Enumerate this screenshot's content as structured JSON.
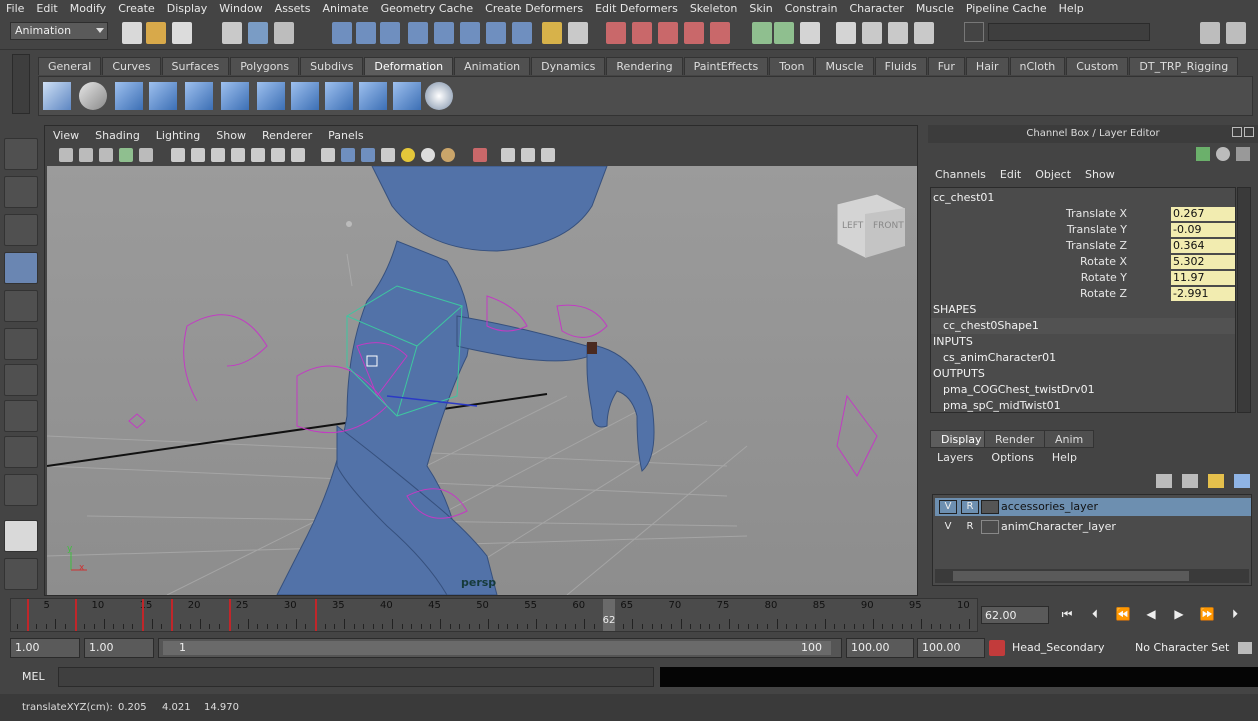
{
  "menubar": [
    "File",
    "Edit",
    "Modify",
    "Create",
    "Display",
    "Window",
    "Assets",
    "Animate",
    "Geometry Cache",
    "Create Deformers",
    "Edit Deformers",
    "Skeleton",
    "Skin",
    "Constrain",
    "Character",
    "Muscle",
    "Pipeline Cache",
    "Help"
  ],
  "status": {
    "mode": "Animation"
  },
  "shelf": {
    "tabs": [
      "General",
      "Curves",
      "Surfaces",
      "Polygons",
      "Subdivs",
      "Deformation",
      "Animation",
      "Dynamics",
      "Rendering",
      "PaintEffects",
      "Toon",
      "Muscle",
      "Fluids",
      "Fur",
      "Hair",
      "nCloth",
      "Custom",
      "DT_TRP_Rigging"
    ],
    "active": "Deformation"
  },
  "viewport": {
    "menu": [
      "View",
      "Shading",
      "Lighting",
      "Show",
      "Renderer",
      "Panels"
    ],
    "camera_label": "persp",
    "cube_left": "LEFT",
    "cube_front": "FRONT",
    "axis_y": "y",
    "axis_x": "x"
  },
  "channelbox": {
    "title": "Channel Box / Layer Editor",
    "menu": [
      "Channels",
      "Edit",
      "Object",
      "Show"
    ],
    "object": "cc_chest01",
    "attrs": [
      {
        "name": "Translate X",
        "value": "0.267"
      },
      {
        "name": "Translate Y",
        "value": "-0.09"
      },
      {
        "name": "Translate Z",
        "value": "0.364"
      },
      {
        "name": "Rotate X",
        "value": "5.302"
      },
      {
        "name": "Rotate Y",
        "value": "11.97"
      },
      {
        "name": "Rotate Z",
        "value": "-2.991"
      }
    ],
    "shapes_label": "SHAPES",
    "shape": "cc_chest0Shape1",
    "inputs_label": "INPUTS",
    "input": "cs_animCharacter01",
    "outputs_label": "OUTPUTS",
    "outputs": [
      "pma_COGChest_twistDrv01",
      "pma_spC_midTwist01"
    ]
  },
  "layers": {
    "tabs": [
      "Display",
      "Render",
      "Anim"
    ],
    "active": "Display",
    "menu": [
      "Layers",
      "Options",
      "Help"
    ],
    "rows": [
      {
        "v": "V",
        "r": "R",
        "name": "accessories_layer",
        "selected": true
      },
      {
        "v": "V",
        "r": "R",
        "name": "animCharacter_layer",
        "selected": false
      }
    ]
  },
  "timeline": {
    "ticks": [
      "5",
      "10",
      "15",
      "20",
      "25",
      "30",
      "35",
      "40",
      "45",
      "50",
      "55",
      "60",
      "65",
      "70",
      "75",
      "80",
      "85",
      "90",
      "95",
      "10"
    ],
    "current": "62",
    "current_field": "62.00"
  },
  "range": {
    "start": "1.00",
    "start2": "1.00",
    "slider_start": "1",
    "slider_end": "100",
    "end": "100.00",
    "end2": "100.00",
    "anim_layer": "Head_Secondary",
    "char_set": "No Character Set"
  },
  "mel": {
    "label": "MEL"
  },
  "help": {
    "text": "translateXYZ(cm):",
    "x": "0.205",
    "y": "4.021",
    "z": "14.970"
  }
}
